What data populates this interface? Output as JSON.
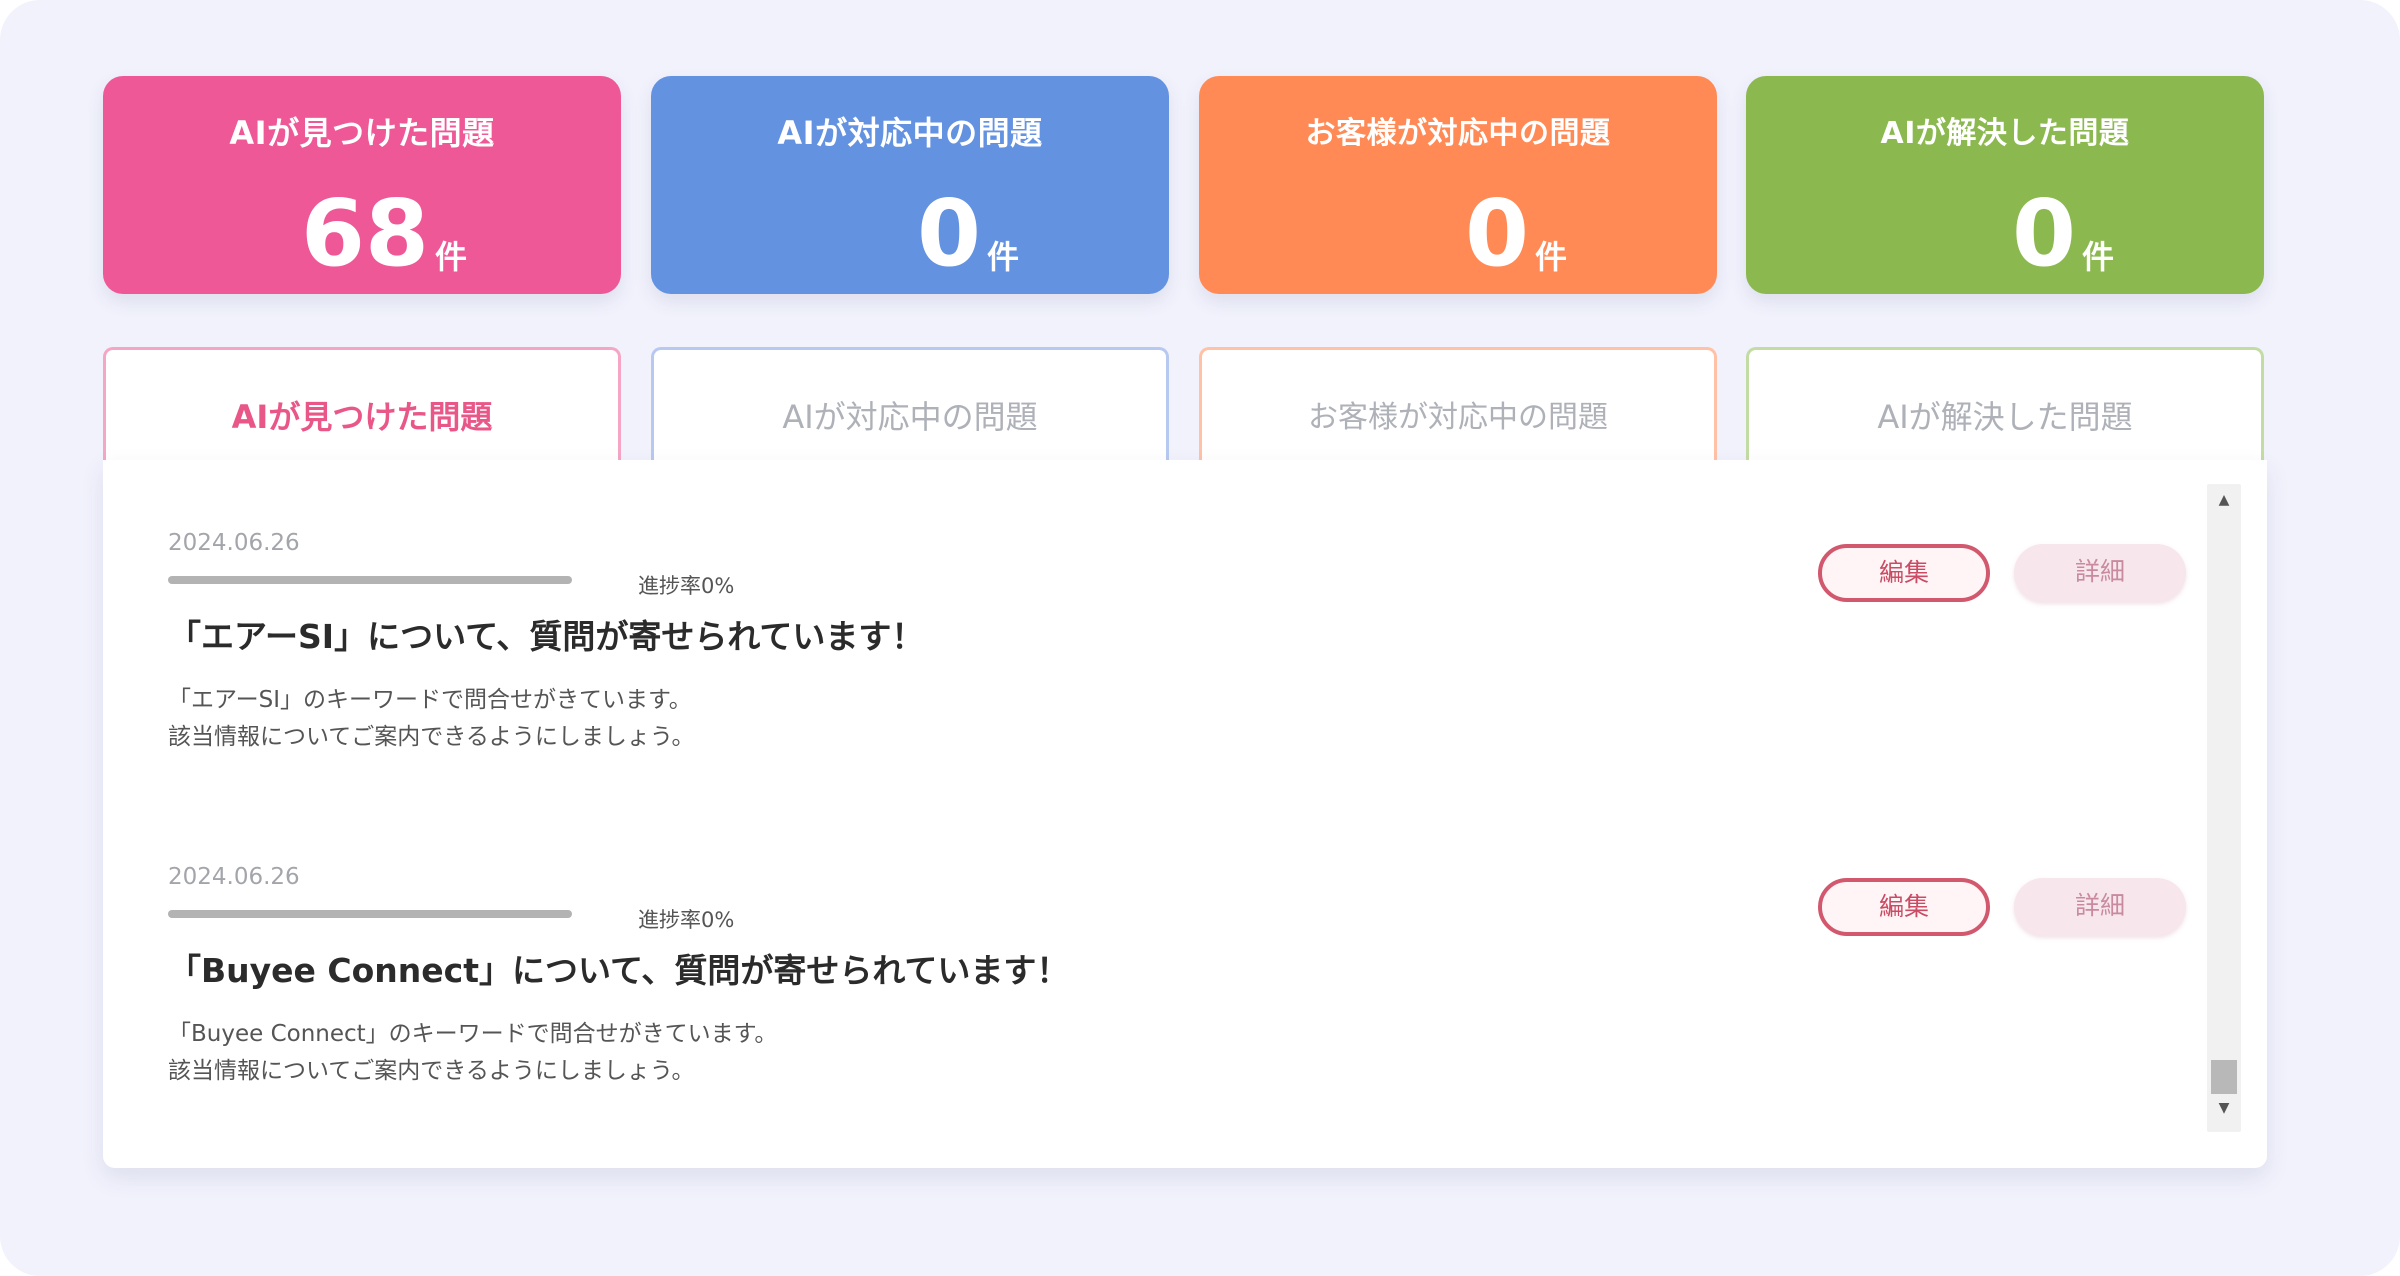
{
  "stat_cards": [
    {
      "title": "AIが見つけた問題",
      "value": "68",
      "unit": "件",
      "color": "#ee5897"
    },
    {
      "title": "AIが対応中の問題",
      "value": "0",
      "unit": "件",
      "color": "#6392e1"
    },
    {
      "title": "お客様が対応中の問題",
      "value": "0",
      "unit": "件",
      "color": "#ff8a56"
    },
    {
      "title": "AIが解決した問題",
      "value": "0",
      "unit": "件",
      "color": "#8bb84f"
    }
  ],
  "tabs": [
    {
      "label": "AIが見つけた問題",
      "border_color": "#f4a6c4",
      "active": true
    },
    {
      "label": "AIが対応中の問題",
      "border_color": "#b7c9f0",
      "active": false
    },
    {
      "label": "お客様が対応中の問題",
      "border_color": "#ffc2a6",
      "active": false
    },
    {
      "label": "AIが解決した問題",
      "border_color": "#c3dca3",
      "active": false
    }
  ],
  "items": [
    {
      "date": "2024.06.26",
      "progress_label": "進捗率0%",
      "progress": 0,
      "title": "「エアーSI」について、質問が寄せられています！",
      "desc_line1": "「エアーSI」のキーワードで問合せがきています。",
      "desc_line2": "該当情報についてご案内できるようにしましょう。",
      "edit_label": "編集",
      "detail_label": "詳細"
    },
    {
      "date": "2024.06.26",
      "progress_label": "進捗率0%",
      "progress": 0,
      "title": "「Buyee Connect」について、質問が寄せられています！",
      "desc_line1": "「Buyee Connect」のキーワードで問合せがきています。",
      "desc_line2": "該当情報についてご案内できるようにしましょう。",
      "edit_label": "編集",
      "detail_label": "詳細"
    }
  ],
  "scrollbar": {
    "up_icon": "scroll-up-arrow",
    "down_icon": "scroll-down-arrow"
  }
}
